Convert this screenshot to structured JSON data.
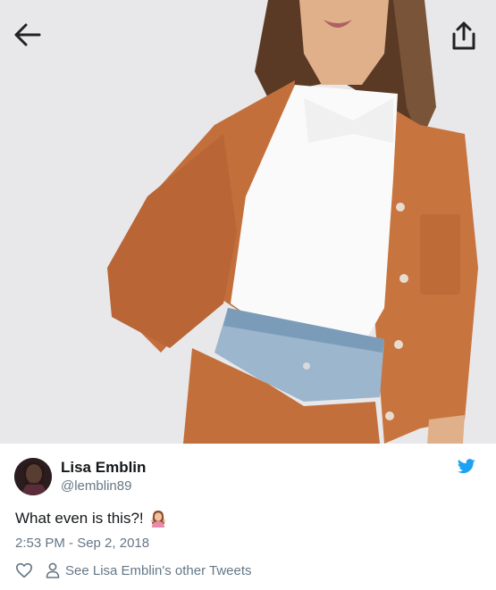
{
  "tweet": {
    "author_name": "Lisa Emblin",
    "author_handle": "@lemblin89",
    "text": "What even is this?!",
    "timestamp": "2:53 PM - Sep 2, 2018",
    "other_tweets_label": "See Lisa Emblin's other Tweets"
  },
  "icons": {
    "back": "arrow-left-icon",
    "share": "share-icon",
    "brand": "twitter-bird-icon",
    "like": "heart-icon",
    "profile": "person-icon",
    "emoji": "woman-shrugging-emoji"
  },
  "colors": {
    "brand": "#1da1f2",
    "secondary_text": "#657786",
    "primary_text": "#14171a",
    "jacket": "#c8743f"
  }
}
